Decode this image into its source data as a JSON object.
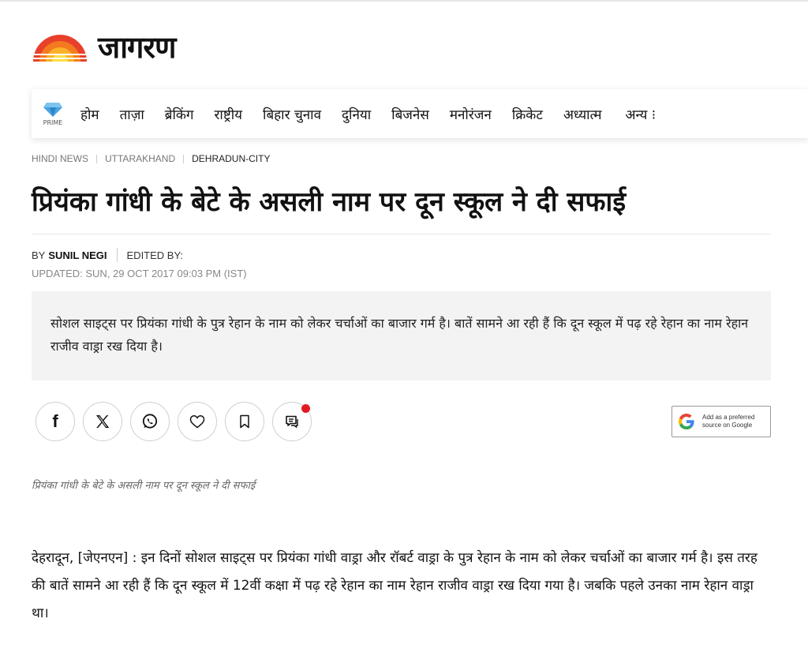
{
  "logo": {
    "text": "जागरण"
  },
  "nav": {
    "prime_label": "PRIME",
    "items": [
      "होम",
      "ताज़ा",
      "ब्रेकिंग",
      "राष्ट्रीय",
      "बिहार चुनाव",
      "दुनिया",
      "बिजनेस",
      "मनोरंजन",
      "क्रिकेट",
      "अध्यात्म"
    ],
    "more_label": "अन्य ⁝"
  },
  "breadcrumb": [
    "HINDI NEWS",
    "UTTARAKHAND",
    "DEHRADUN-CITY"
  ],
  "article": {
    "title": "प्रियंका गांधी के बेटे के असली नाम पर दून स्कूल ने दी सफाई",
    "by_prefix": "BY",
    "author": "SUNIL NEGI",
    "edited_by": "EDITED BY:",
    "updated": "UPDATED: SUN, 29 OCT 2017 09:03 PM (IST)",
    "summary": "सोशल साइट्स पर प्रियंका गांधी के पुत्र रेहान के नाम को लेकर चर्चाओं का बाजार गर्म है। बातें सामने आ रही हैं कि दून स्कूल में पढ़ रहे रेहान का नाम रेहान राजीव वाड्रा रख दिया है।",
    "caption": "प्रियंका गांधी के बेटे के असली नाम पर दून स्कूल ने दी सफाई",
    "body": "देहरादून, [जेएनएन] : इन दिनों सोशल साइट्स पर प्रियंका गांधी वाड्रा और रॉबर्ट वाड्रा के पुत्र रेहान के नाम को लेकर चर्चाओं का बाजार गर्म है। इस तरह की बातें सामने आ रही हैं कि दून स्कूल में 12वीं कक्षा में पढ़ रहे रेहान का नाम रेहान राजीव वाड्रा रख दिया गया है। जबकि पहले उनका नाम रेहान वाड्रा था।"
  },
  "share": {
    "facebook_label": "f",
    "google_button": "Add as a preferred source on Google"
  },
  "colors": {
    "notification_dot": "#e21b23",
    "summary_bg": "#f3f3f3"
  }
}
